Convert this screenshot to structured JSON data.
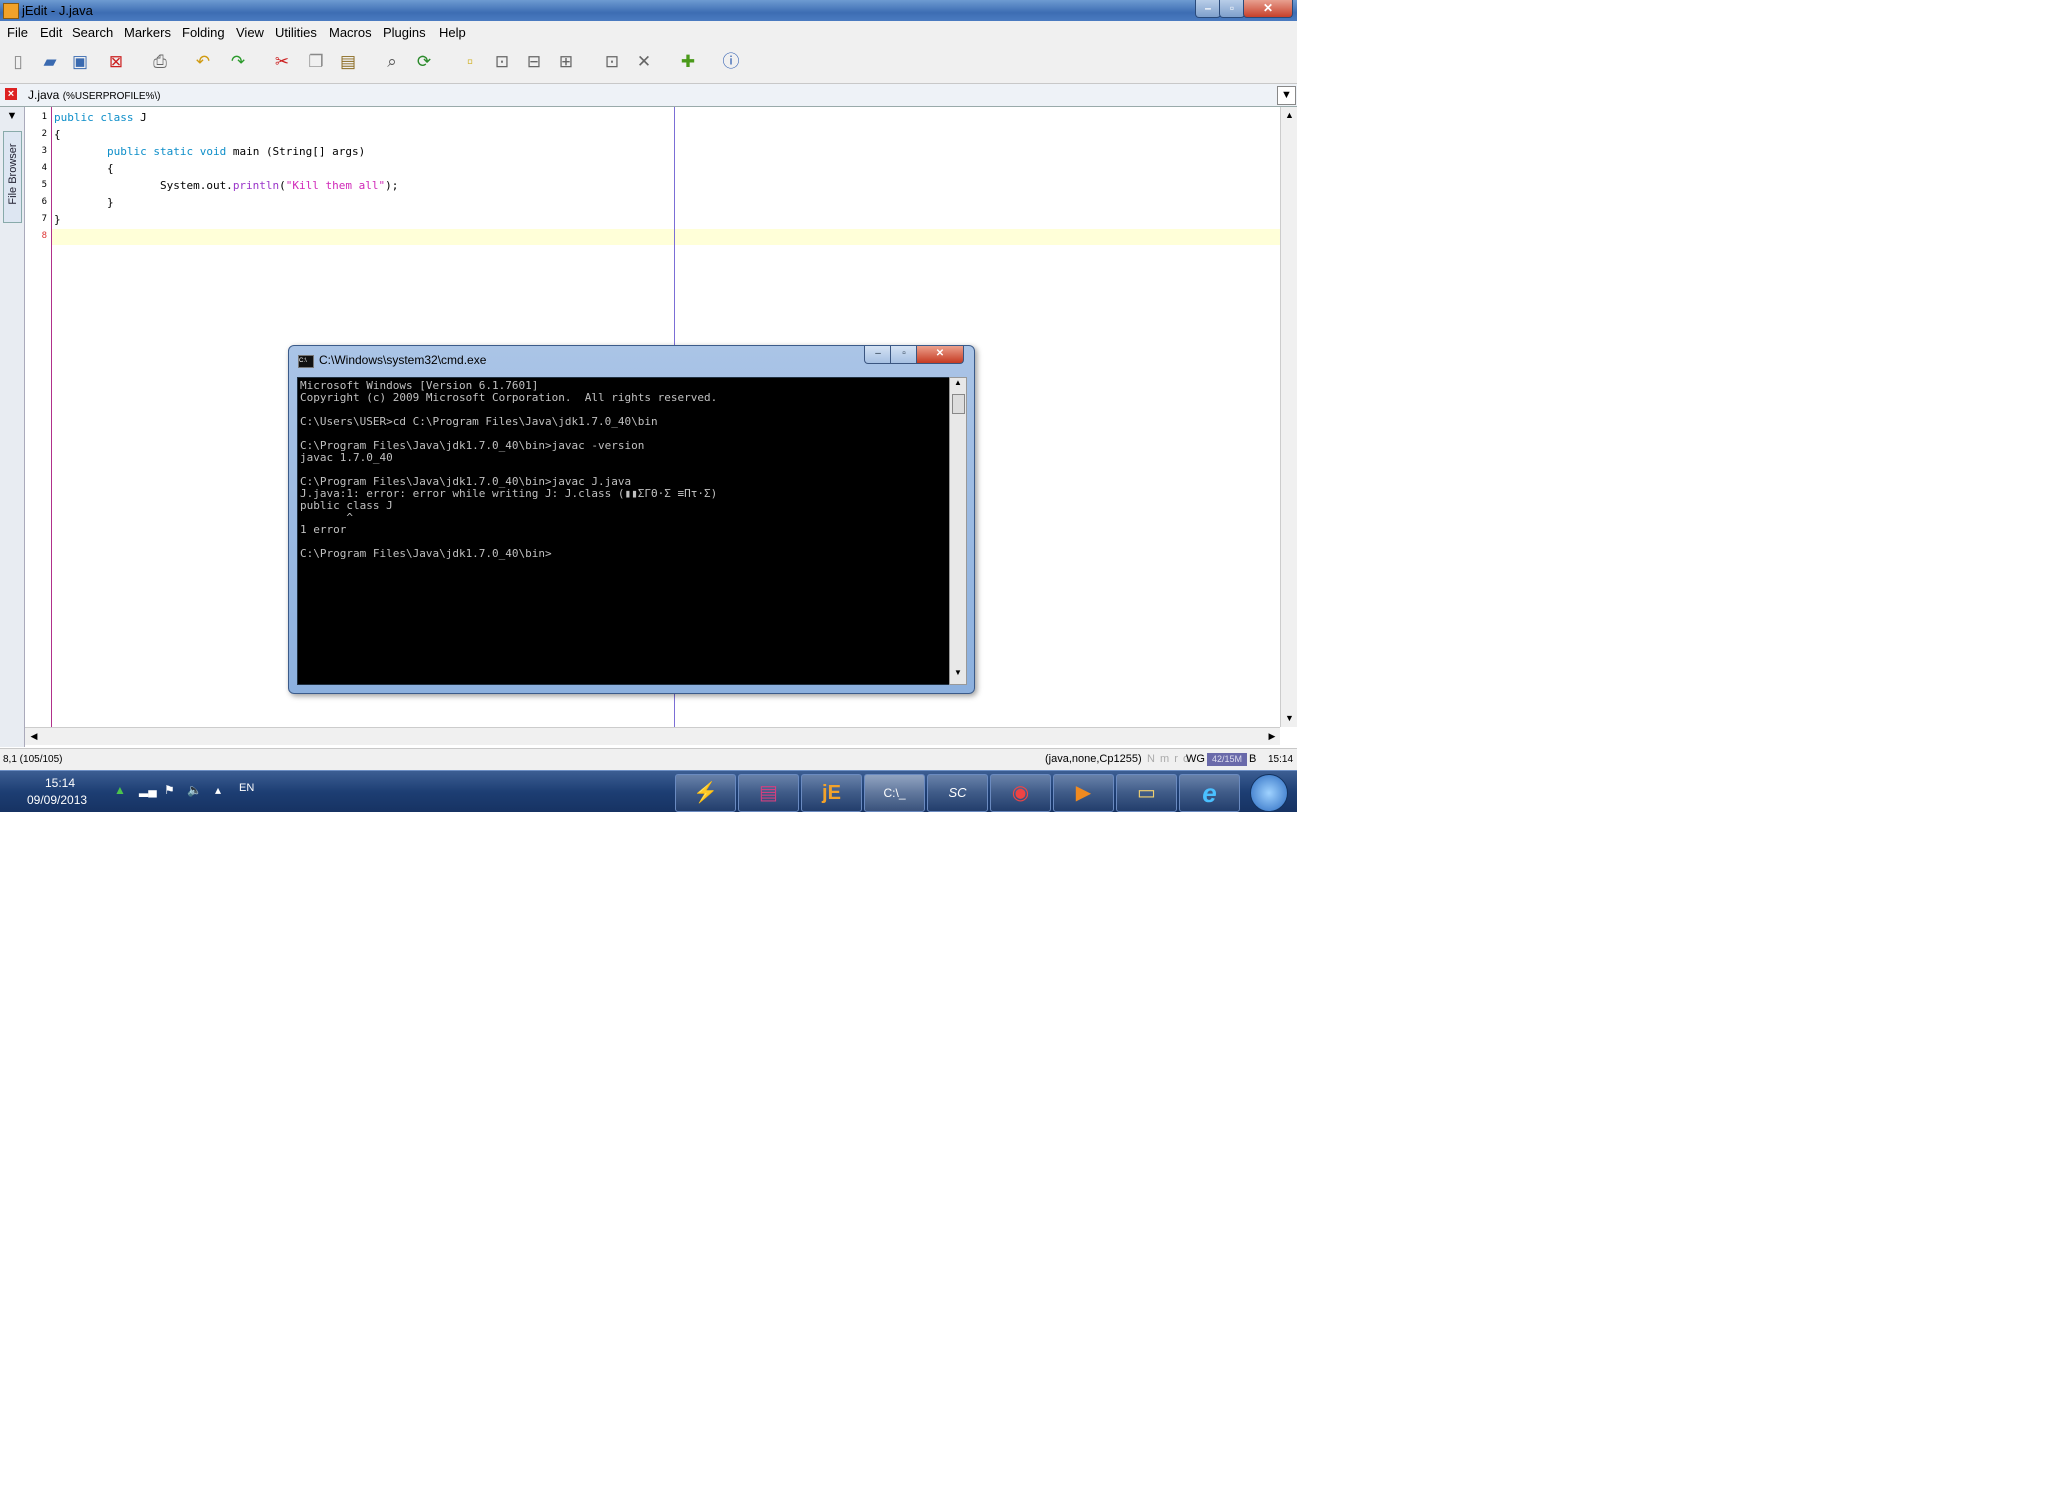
{
  "window": {
    "title": "jEdit - J.java"
  },
  "menu": [
    "File",
    "Edit",
    "Search",
    "Markers",
    "Folding",
    "View",
    "Utilities",
    "Macros",
    "Plugins",
    "Help"
  ],
  "buffer": {
    "name": "J.java",
    "path": "(%USERPROFILE%\\)"
  },
  "dock": {
    "file_browser_label": "File Browser"
  },
  "editor": {
    "line_numbers": [
      "1",
      "2",
      "3",
      "4",
      "5",
      "6",
      "7",
      "8"
    ],
    "lines": [
      [
        {
          "t": "public class",
          "c": "kw"
        },
        {
          "t": " J",
          "c": "n"
        }
      ],
      [
        {
          "t": "{",
          "c": "n"
        }
      ],
      [
        {
          "t": "        ",
          "c": "n"
        },
        {
          "t": "public static void",
          "c": "kw"
        },
        {
          "t": " main (String[] args)",
          "c": "n"
        }
      ],
      [
        {
          "t": "        {",
          "c": "n"
        }
      ],
      [
        {
          "t": "                System.out.",
          "c": "n"
        },
        {
          "t": "println",
          "c": "fn"
        },
        {
          "t": "(",
          "c": "n"
        },
        {
          "t": "\"Kill them all\"",
          "c": "str"
        },
        {
          "t": ");",
          "c": "n"
        }
      ],
      [
        {
          "t": "        }",
          "c": "n"
        }
      ],
      [
        {
          "t": "}",
          "c": "n"
        }
      ],
      [
        {
          "t": "",
          "c": "n"
        }
      ]
    ]
  },
  "status": {
    "position": "8,1 (105/105)",
    "mode": "(java,none,Cp1255)",
    "flags": "N m r o",
    "wg": "WG",
    "memory": "42/15M",
    "b": "B",
    "time": "15:14"
  },
  "cmd": {
    "title": "C:\\Windows\\system32\\cmd.exe",
    "output": "Microsoft Windows [Version 6.1.7601]\nCopyright (c) 2009 Microsoft Corporation.  All rights reserved.\n\nC:\\Users\\USER>cd C:\\Program Files\\Java\\jdk1.7.0_40\\bin\n\nC:\\Program Files\\Java\\jdk1.7.0_40\\bin>javac -version\njavac 1.7.0_40\n\nC:\\Program Files\\Java\\jdk1.7.0_40\\bin>javac J.java\nJ.java:1: error: error while writing J: J.class (▮▮ΣΓΘ·Σ ≡Πτ·Σ)\npublic class J\n       ^\n1 error\n\nC:\\Program Files\\Java\\jdk1.7.0_40\\bin>"
  },
  "taskbar": {
    "time": "15:14",
    "date": "09/09/2013",
    "lang": "EN",
    "apps": [
      {
        "icon": "⚡",
        "name": "winamp"
      },
      {
        "icon": "▤",
        "name": "winrar"
      },
      {
        "icon": "jE",
        "name": "jedit"
      },
      {
        "icon": "C:\\_",
        "name": "cmd"
      },
      {
        "icon": "SC",
        "name": "scheme"
      },
      {
        "icon": "◉",
        "name": "chrome"
      },
      {
        "icon": "▶",
        "name": "media-player"
      },
      {
        "icon": "▭",
        "name": "explorer"
      },
      {
        "icon": "e",
        "name": "internet-explorer"
      }
    ]
  },
  "colors": {
    "keyword": "#0d8ec9",
    "function": "#9a35c9",
    "string": "#d028b8",
    "gutter_border": "#b0308a"
  }
}
